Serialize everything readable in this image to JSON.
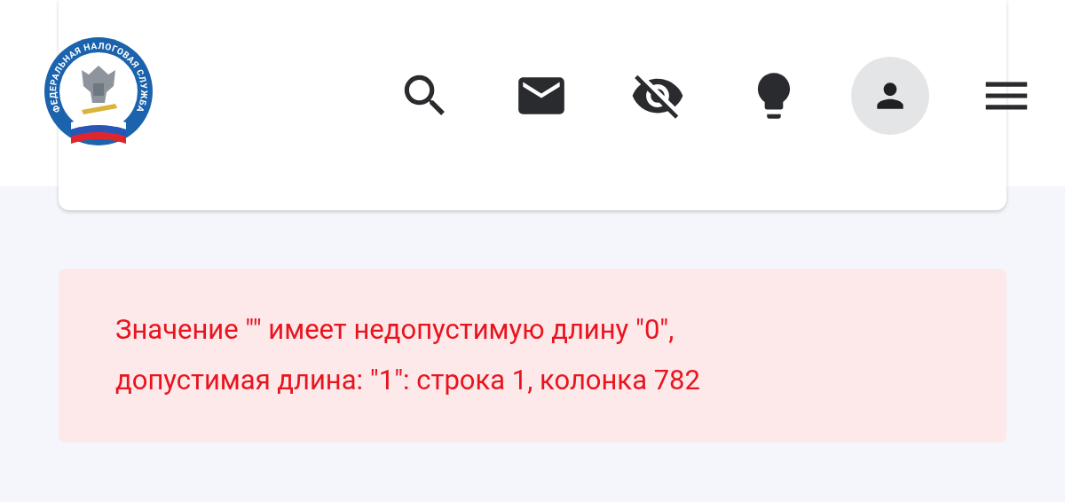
{
  "header": {
    "logo_text": "ФЕДЕРАЛЬНАЯ НАЛОГОВАЯ СЛУЖБА",
    "actions": [
      {
        "kind": "search"
      },
      {
        "kind": "mail"
      },
      {
        "kind": "accessibility"
      },
      {
        "kind": "hint"
      },
      {
        "kind": "profile"
      },
      {
        "kind": "menu"
      }
    ]
  },
  "error": {
    "lines": [
      "Значение \"\" имеет недопустимую длину \"0\",",
      "допустимая длина: \"1\": строка 1, колонка 782"
    ]
  }
}
